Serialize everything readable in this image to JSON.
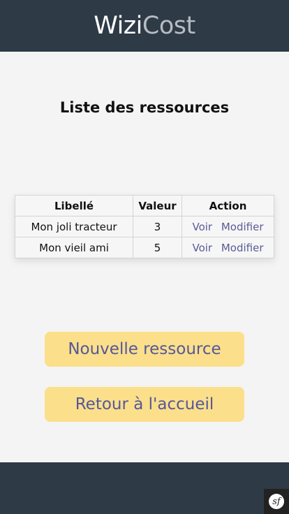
{
  "header": {
    "brand_part1": "Wizi",
    "brand_part2": "Cost"
  },
  "main": {
    "title": "Liste des ressources",
    "table": {
      "columns": [
        "Libellé",
        "Valeur",
        "Action"
      ],
      "rows": [
        {
          "label": "Mon joli tracteur",
          "value": "3",
          "view_label": "Voir",
          "edit_label": "Modifier"
        },
        {
          "label": "Mon vieil ami",
          "value": "5",
          "view_label": "Voir",
          "edit_label": "Modifier"
        }
      ]
    },
    "buttons": {
      "new_label": "Nouvelle ressource",
      "back_label": "Retour à l'accueil"
    }
  },
  "footer": {
    "badge_icon": "symfony-icon",
    "badge_text": "sf"
  },
  "colors": {
    "header_bg": "#2e3a46",
    "button_bg": "#fbdf8a",
    "button_text": "#55579a",
    "link": "#5a5a9a"
  }
}
